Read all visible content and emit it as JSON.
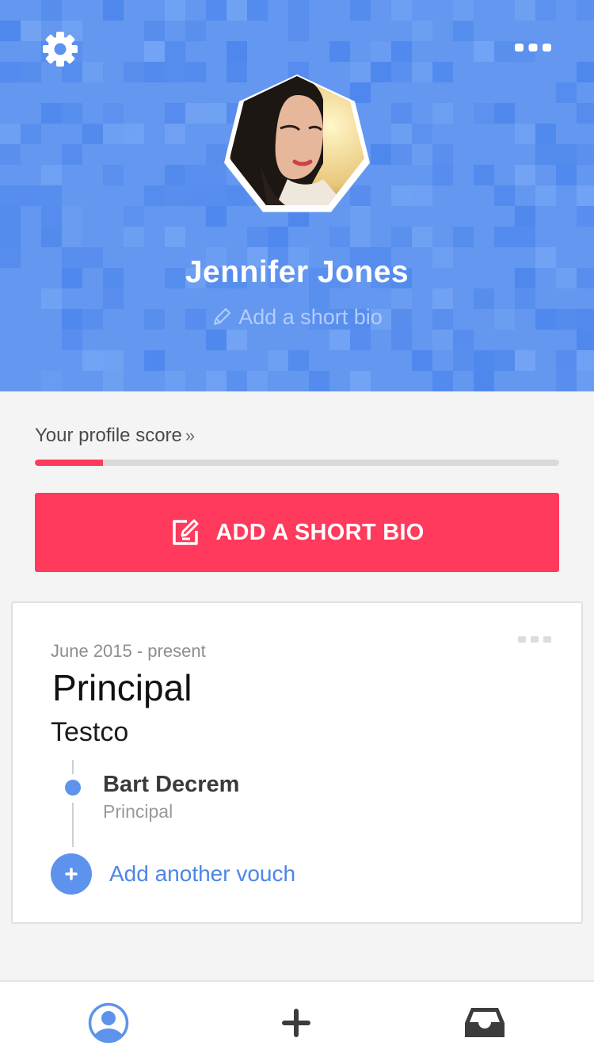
{
  "colors": {
    "header_bg": "#6397f0",
    "header_tile_dark": "#4a84ec",
    "header_tile_light": "#76a6f4",
    "accent_red": "#ff3a5c",
    "accent_blue": "#5d93ec",
    "link_blue": "#4c86e6"
  },
  "header": {
    "settings_icon": "gear-icon",
    "more_icon": "ellipsis-icon",
    "avatar_icon": "profile-photo",
    "name": "Jennifer Jones",
    "bio_placeholder": "Add a short bio",
    "bio_icon": "pencil-icon"
  },
  "profile_score": {
    "label": "Your profile score",
    "chevron": "»",
    "progress_fraction": 0.13
  },
  "cta": {
    "label": "ADD A SHORT BIO",
    "icon": "edit-icon"
  },
  "experience": {
    "date_range": "June 2015 - present",
    "title": "Principal",
    "company": "Testco",
    "vouches": [
      {
        "name": "Bart Decrem",
        "role": "Principal"
      }
    ],
    "add_vouch_label": "Add another vouch",
    "more_icon": "ellipsis-icon"
  },
  "tabbar": {
    "items": [
      {
        "icon": "profile-icon",
        "active": true
      },
      {
        "icon": "plus-icon",
        "active": false
      },
      {
        "icon": "inbox-icon",
        "active": false
      }
    ]
  }
}
